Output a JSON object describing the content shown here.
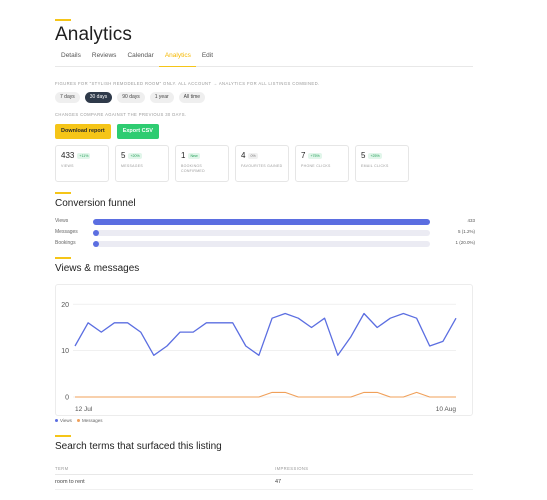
{
  "header": {
    "title": "Analytics"
  },
  "tabs": [
    {
      "label": "Details",
      "active": false
    },
    {
      "label": "Reviews",
      "active": false
    },
    {
      "label": "Calendar",
      "active": false
    },
    {
      "label": "Analytics",
      "active": true
    },
    {
      "label": "Edit",
      "active": false
    }
  ],
  "figures_note": "FIGURES FOR \"STYLISH REMODELED ROOM\" ONLY. ALL ACCOUNT → ANALYTICS FOR ALL LISTINGS COMBINED.",
  "ranges": [
    {
      "label": "7 days",
      "active": false
    },
    {
      "label": "30 days",
      "active": true
    },
    {
      "label": "90 days",
      "active": false
    },
    {
      "label": "1 year",
      "active": false
    },
    {
      "label": "All time",
      "active": false
    }
  ],
  "compare_note": "CHANGES COMPARE AGAINST THE PREVIOUS 30 DAYS.",
  "actions": {
    "download_label": "Download report",
    "export_label": "Export CSV"
  },
  "kpis": [
    {
      "value": "433",
      "badge": "+11%",
      "label": "VIEWS"
    },
    {
      "value": "5",
      "badge": "+20%",
      "label": "MESSAGES"
    },
    {
      "value": "1",
      "badge": "New",
      "label": "BOOKINGS CONFIRMED"
    },
    {
      "value": "4",
      "badge": "0%",
      "label": "FAVOURITES GAINED"
    },
    {
      "value": "7",
      "badge": "+75%",
      "label": "PHONE CLICKS"
    },
    {
      "value": "5",
      "badge": "+25%",
      "label": "EMAIL CLICKS"
    }
  ],
  "funnel": {
    "title": "Conversion funnel",
    "rows": [
      {
        "label": "Views",
        "value": "433",
        "fraction": 1.0
      },
      {
        "label": "Messages",
        "value": "5 (1.2%)",
        "fraction": 0.012
      },
      {
        "label": "Bookings",
        "value": "1 (20.0%)",
        "fraction": 0.002
      }
    ]
  },
  "chart_section_title": "Views & messages",
  "colors": {
    "accent": "#f5c518",
    "views": "#5b6ee1",
    "messages": "#f0a05a"
  },
  "chart_data": {
    "type": "line",
    "x_tick_labels": [
      "12 Jul",
      "10 Aug"
    ],
    "ylim": [
      0,
      22
    ],
    "y_ticks": [
      0,
      10,
      20
    ],
    "grid": true,
    "legend_position": "bottom-left",
    "series": [
      {
        "name": "Views",
        "values": [
          11,
          16,
          14,
          16,
          16,
          14,
          9,
          11,
          14,
          14,
          16,
          16,
          16,
          11,
          9,
          17,
          18,
          17,
          15,
          17,
          9,
          13,
          18,
          15,
          17,
          18,
          17,
          11,
          12,
          17
        ]
      },
      {
        "name": "Messages",
        "values": [
          0,
          0,
          0,
          0,
          0,
          0,
          0,
          0,
          0,
          0,
          0,
          0,
          0,
          0,
          0,
          1,
          1,
          0,
          0,
          0,
          0,
          0,
          1,
          1,
          0,
          0,
          1,
          0,
          0,
          0
        ]
      }
    ]
  },
  "search_terms": {
    "title": "Search terms that surfaced this listing",
    "columns": [
      "TERM",
      "IMPRESSIONS"
    ],
    "rows": [
      {
        "term": "room to rent",
        "impressions": "47"
      }
    ]
  }
}
